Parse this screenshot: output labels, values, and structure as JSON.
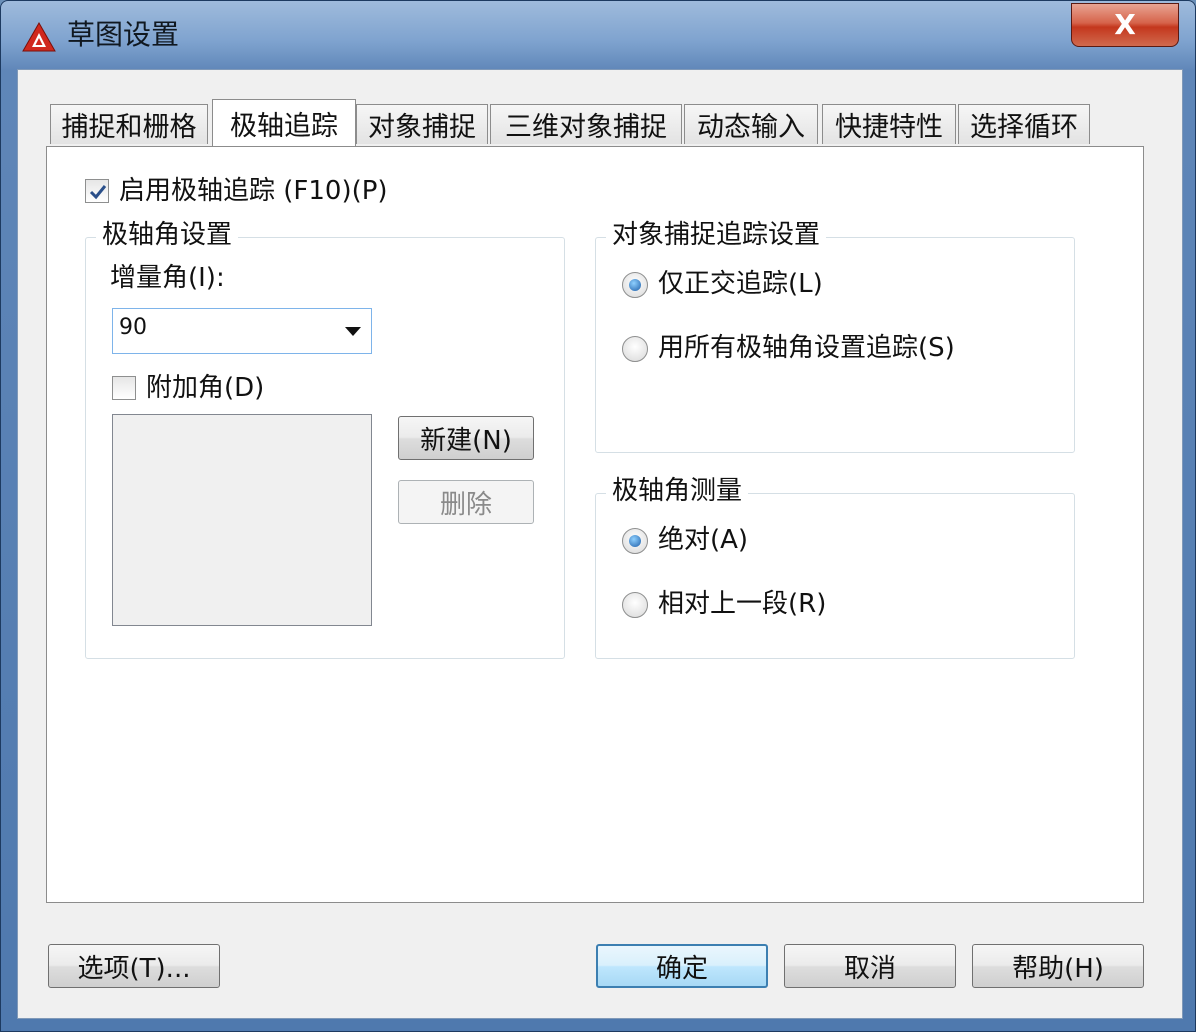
{
  "window": {
    "title": "草图设置",
    "close_label": "X"
  },
  "tabs": [
    {
      "label": "捕捉和栅格",
      "active": false
    },
    {
      "label": "极轴追踪",
      "active": true
    },
    {
      "label": "对象捕捉",
      "active": false
    },
    {
      "label": "三维对象捕捉",
      "active": false
    },
    {
      "label": "动态输入",
      "active": false
    },
    {
      "label": "快捷特性",
      "active": false
    },
    {
      "label": "选择循环",
      "active": false
    }
  ],
  "polar": {
    "enable_label": "启用极轴追踪 (F10)(P)",
    "enable_checked": true,
    "angle_group": {
      "title": "极轴角设置",
      "increment_label": "增量角(I):",
      "increment_value": "90",
      "additional_label": "附加角(D)",
      "additional_checked": false,
      "new_button": "新建(N)",
      "delete_button": "删除"
    },
    "osnap_group": {
      "title": "对象捕捉追踪设置",
      "option_ortho": "仅正交追踪(L)",
      "option_all": "用所有极轴角设置追踪(S)",
      "selected": "ortho"
    },
    "measure_group": {
      "title": "极轴角测量",
      "option_absolute": "绝对(A)",
      "option_relative": "相对上一段(R)",
      "selected": "absolute"
    }
  },
  "footer": {
    "options_button": "选项(T)...",
    "ok_button": "确定",
    "cancel_button": "取消",
    "help_button": "帮助(H)"
  },
  "colors": {
    "app_icon": "#d0281e",
    "title_bar": "#7fa3cf",
    "close_button": "#c4371d",
    "default_button_border": "#3c7fb1"
  }
}
